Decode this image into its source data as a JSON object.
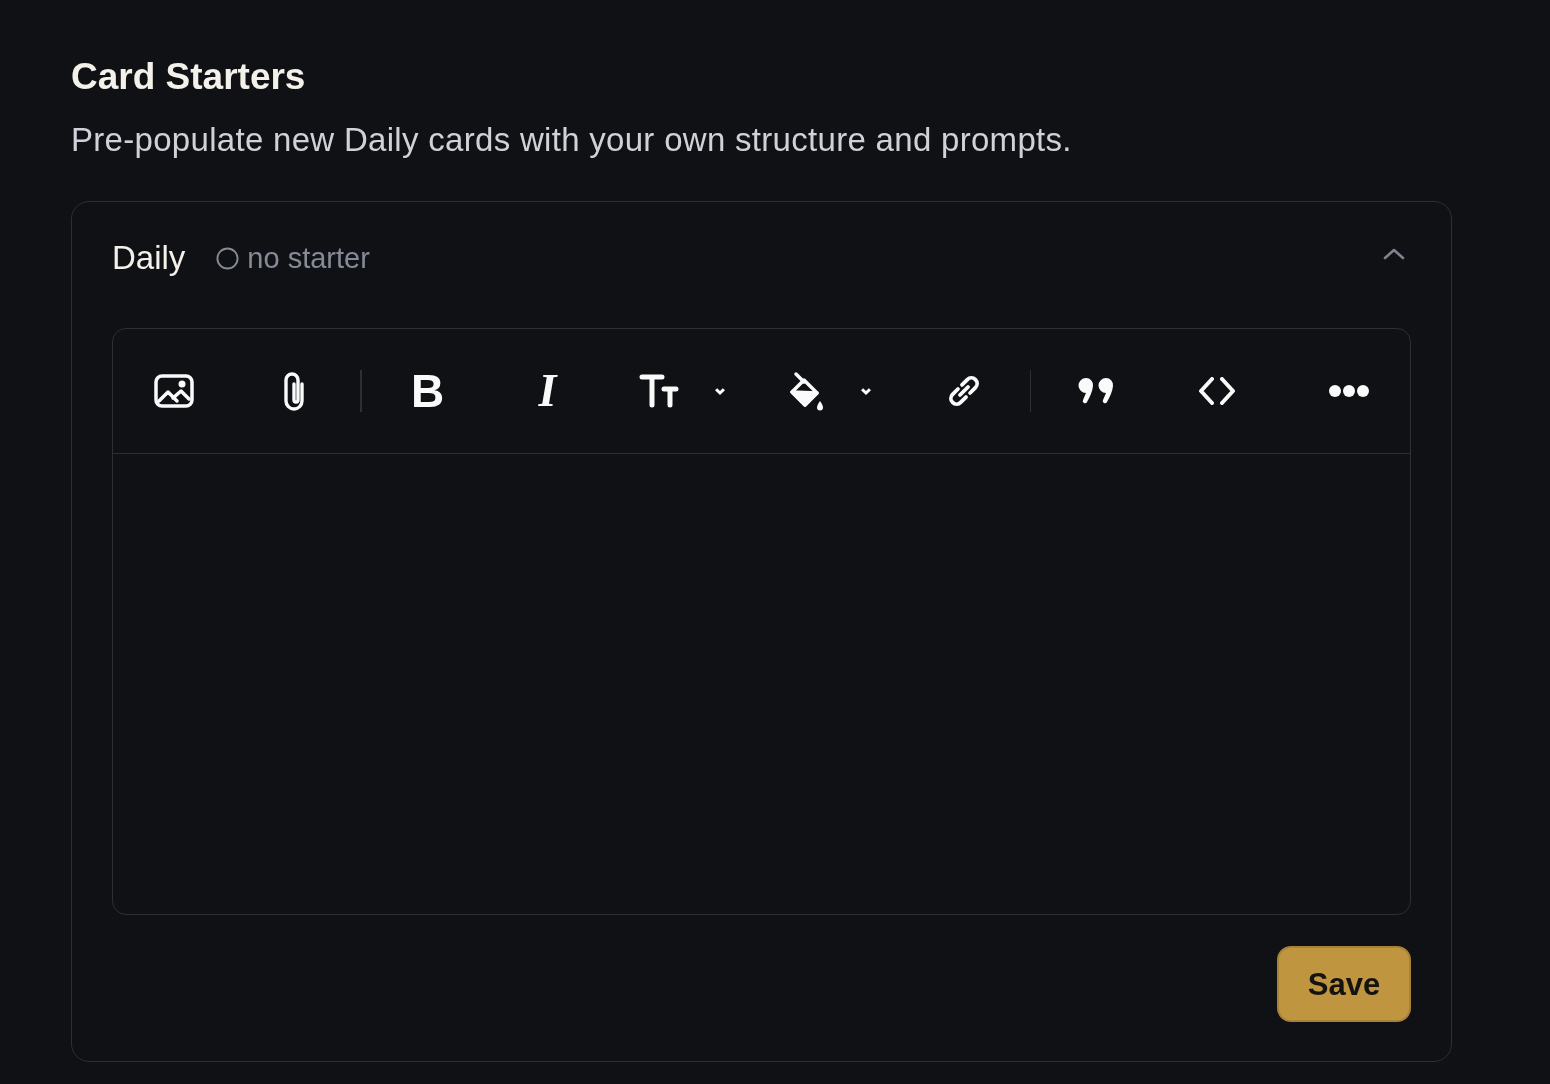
{
  "section": {
    "title": "Card Starters",
    "description": "Pre-populate new Daily cards with your own structure and prompts."
  },
  "card": {
    "title": "Daily",
    "expanded": true,
    "status": {
      "kind": "empty",
      "label": "no starter"
    },
    "editor": {
      "toolbar": [
        {
          "tools": [
            {
              "kind": "image",
              "dropdown": false
            },
            {
              "kind": "attachment",
              "dropdown": false
            }
          ]
        },
        {
          "tools": [
            {
              "kind": "bold",
              "glyph": "B",
              "dropdown": false
            },
            {
              "kind": "italic",
              "glyph": "I",
              "dropdown": false
            },
            {
              "kind": "text-size",
              "dropdown": true
            },
            {
              "kind": "fill-color",
              "dropdown": true
            },
            {
              "kind": "link",
              "dropdown": false
            }
          ]
        },
        {
          "tools": [
            {
              "kind": "quote",
              "dropdown": false
            },
            {
              "kind": "code",
              "dropdown": false
            },
            {
              "kind": "more",
              "dropdown": false
            }
          ]
        }
      ]
    },
    "actions": [
      {
        "kind": "save",
        "label": "Save"
      }
    ]
  }
}
